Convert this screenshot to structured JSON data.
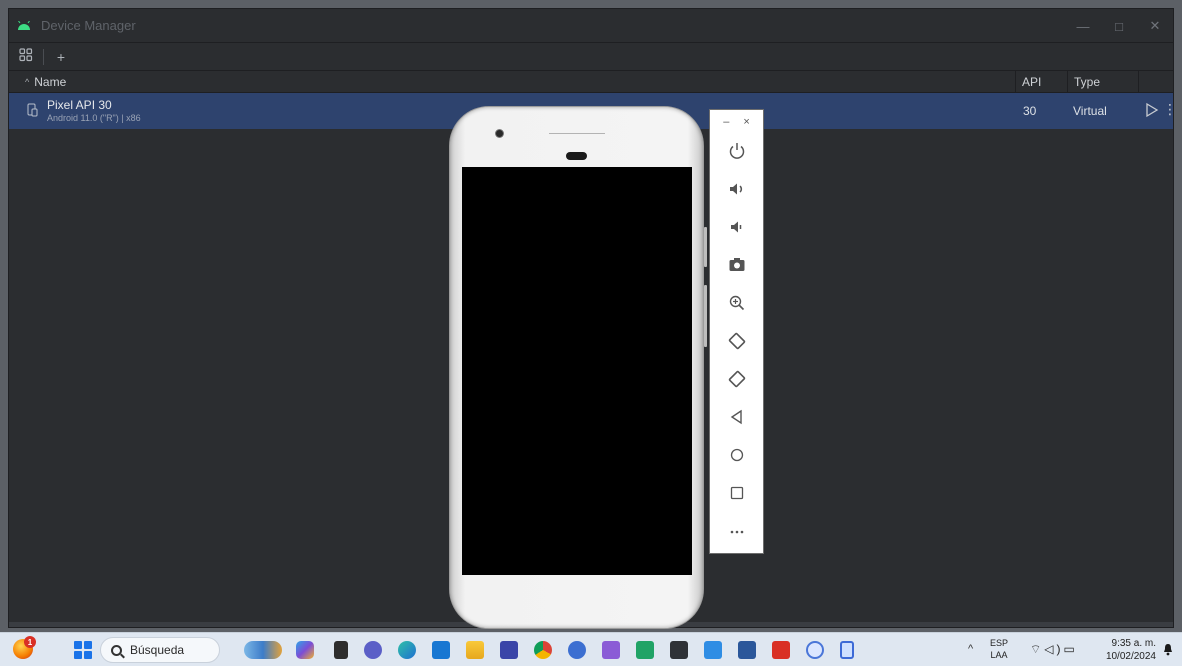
{
  "window": {
    "title": "Device Manager",
    "controls": {
      "minimize": "—",
      "maximize": "□",
      "close": "✕"
    }
  },
  "toolbar": {
    "device_group_icon": "grid-icon",
    "add_label": "+"
  },
  "table": {
    "columns": {
      "name": "Name",
      "api": "API",
      "type": "Type"
    },
    "sort_indicator": "^",
    "rows": [
      {
        "name": "Pixel API 30",
        "subtitle": "Android 11.0 (\"R\") | x86",
        "api": "30",
        "type": "Virtual"
      }
    ]
  },
  "emulator_toolbar": {
    "minimize": "–",
    "close": "×",
    "buttons": [
      "power-icon",
      "volume-up-icon",
      "volume-down-icon",
      "camera-icon",
      "zoom-icon",
      "rotate-left-icon",
      "rotate-right-icon",
      "back-icon",
      "home-icon",
      "overview-icon",
      "more-icon"
    ]
  },
  "taskbar": {
    "search_placeholder": "Búsqueda",
    "notification_count": "1",
    "tray": {
      "caret": "^",
      "lang_top": "ESP",
      "lang_bottom": "LAA",
      "time": "9:35 a. m.",
      "date": "10/02/2024"
    },
    "pinned_apps": [
      "widgets",
      "copilot",
      "file-app",
      "teams",
      "edge",
      "mail",
      "explorer",
      "visual-studio-code",
      "chrome",
      "app-cube",
      "visual-studio",
      "excel-app",
      "terminal",
      "node-app",
      "word",
      "acrobat",
      "star-app",
      "vertical-app"
    ]
  },
  "colors": {
    "ide_bg": "#2b2d30",
    "selected_row": "#2e436e",
    "taskbar_bg": "#dfe7f1",
    "accent_green": "#3ddc84"
  }
}
